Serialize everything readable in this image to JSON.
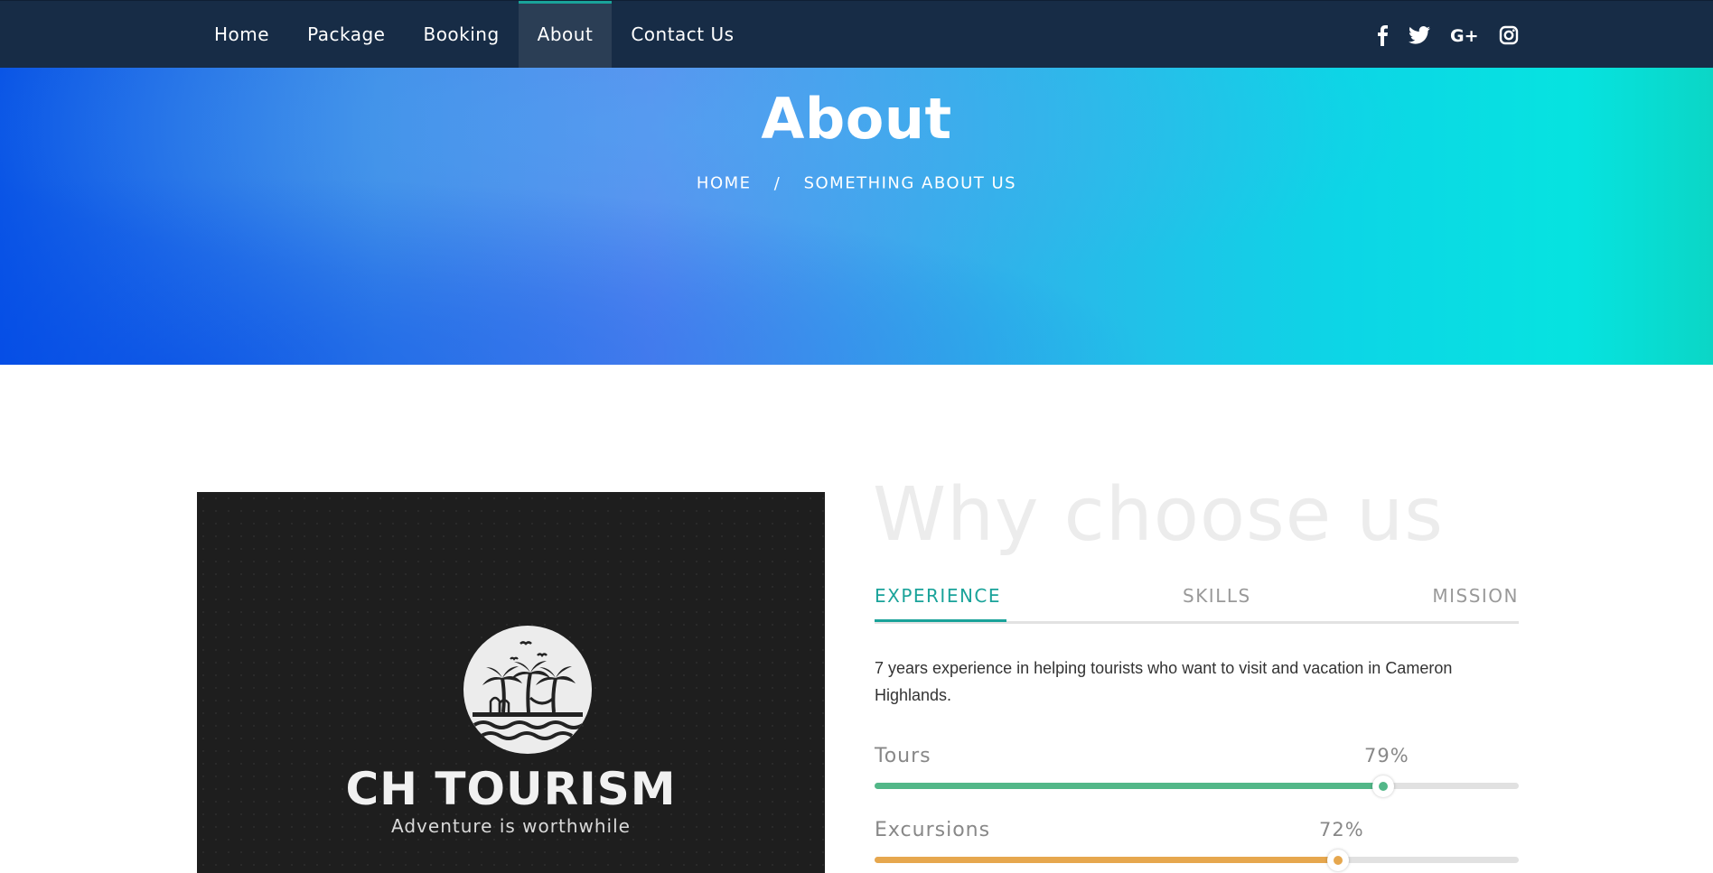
{
  "nav": {
    "items": [
      {
        "label": "Home",
        "active": false
      },
      {
        "label": "Package",
        "active": false
      },
      {
        "label": "Booking",
        "active": false
      },
      {
        "label": "About",
        "active": true
      },
      {
        "label": "Contact Us",
        "active": false
      }
    ],
    "socials": [
      "facebook-icon",
      "twitter-icon",
      "google-plus-icon",
      "instagram-icon"
    ]
  },
  "hero": {
    "title": "About",
    "breadcrumb": {
      "home": "HOME",
      "separator": "/",
      "current": "SOMETHING ABOUT US"
    }
  },
  "brand": {
    "name": "CH TOURISM",
    "tagline": "Adventure is worthwhile"
  },
  "why": {
    "title": "Why choose us",
    "tabs": [
      {
        "label": "EXPERIENCE",
        "active": true
      },
      {
        "label": "SKILLS",
        "active": false
      },
      {
        "label": "MISSION",
        "active": false
      }
    ],
    "description": "7 years experience in helping tourists who want to visit and vacation in Cameron Highlands.",
    "skills": [
      {
        "name": "Tours",
        "percent_label": "79%",
        "percent": 79,
        "color": "#52b788"
      },
      {
        "name": "Excursions",
        "percent_label": "72%",
        "percent": 72,
        "color": "#e6a74e"
      }
    ]
  },
  "colors": {
    "nav_bg": "#172c46",
    "accent": "#1aa39a"
  }
}
